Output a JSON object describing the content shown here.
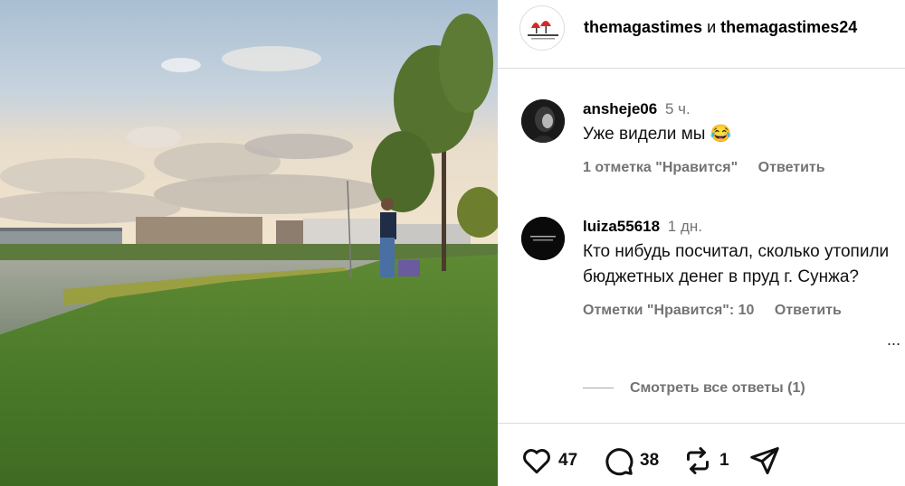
{
  "header": {
    "author1": "themagastimes",
    "joiner": "и",
    "author2": "themagastimes24",
    "logo_icon": "themagastimes-logo"
  },
  "comments": [
    {
      "username": "ansheje06",
      "time": "5 ч.",
      "text": "Уже видели мы 😂",
      "likes_label": "1 отметка \"Нравится\"",
      "reply_label": "Ответить"
    },
    {
      "username": "luiza55618",
      "time": "1 дн.",
      "text": "Кто нибудь посчитал, сколько утопили бюджетных денег в пруд г. Сунжа?",
      "likes_label": "Отметки \"Нравится\": 10",
      "reply_label": "Ответить"
    }
  ],
  "view_replies_label": "Смотреть все ответы (1)",
  "more_label": "...",
  "actions": {
    "likes_count": "47",
    "comments_count": "38",
    "reposts_count": "1",
    "icons": [
      "heart-icon",
      "comment-icon",
      "repost-icon",
      "share-icon"
    ]
  }
}
